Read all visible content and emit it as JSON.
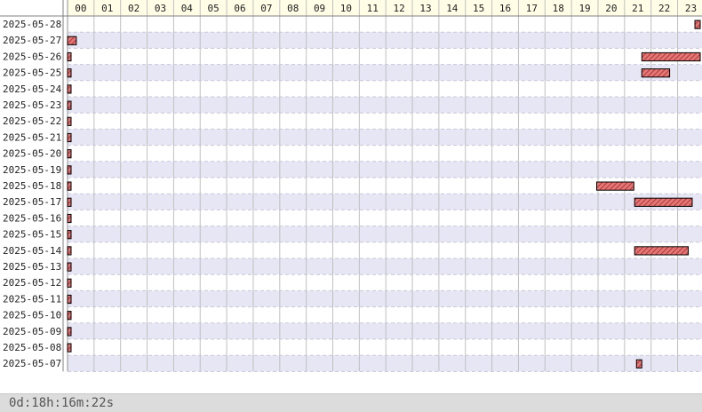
{
  "colors": {
    "header_bg": "#fffde6",
    "row_alt_bg": "#e6e6f5",
    "row_bg": "#ffffff",
    "bar_fill": "#e07878",
    "bar_hatch": "#b02222",
    "bar_border": "#000000",
    "grid_line": "#c0c0c0",
    "footer_bg": "#dcdcdc"
  },
  "hours": [
    "00",
    "01",
    "02",
    "03",
    "04",
    "05",
    "06",
    "07",
    "08",
    "09",
    "10",
    "11",
    "12",
    "13",
    "14",
    "15",
    "16",
    "17",
    "18",
    "19",
    "20",
    "21",
    "22",
    "23"
  ],
  "dates": [
    "2025-05-28",
    "2025-05-27",
    "2025-05-26",
    "2025-05-25",
    "2025-05-24",
    "2025-05-23",
    "2025-05-22",
    "2025-05-21",
    "2025-05-20",
    "2025-05-19",
    "2025-05-18",
    "2025-05-17",
    "2025-05-16",
    "2025-05-15",
    "2025-05-14",
    "2025-05-13",
    "2025-05-12",
    "2025-05-11",
    "2025-05-10",
    "2025-05-09",
    "2025-05-08",
    "2025-05-07"
  ],
  "spans": [
    {
      "row": 0,
      "start": 23.8,
      "end": 24.0
    },
    {
      "row": 1,
      "start": 0.0,
      "end": 0.33
    },
    {
      "row": 2,
      "start": 0.0,
      "end": 0.05
    },
    {
      "row": 2,
      "start": 21.8,
      "end": 24.0
    },
    {
      "row": 3,
      "start": 0.0,
      "end": 0.05
    },
    {
      "row": 3,
      "start": 21.65,
      "end": 22.7
    },
    {
      "row": 4,
      "start": 0.0,
      "end": 0.05
    },
    {
      "row": 5,
      "start": 0.0,
      "end": 0.05
    },
    {
      "row": 6,
      "start": 0.0,
      "end": 0.05
    },
    {
      "row": 7,
      "start": 0.0,
      "end": 0.05
    },
    {
      "row": 8,
      "start": 0.0,
      "end": 0.05
    },
    {
      "row": 9,
      "start": 0.0,
      "end": 0.05
    },
    {
      "row": 10,
      "start": 0.0,
      "end": 0.05
    },
    {
      "row": 10,
      "start": 19.95,
      "end": 21.35
    },
    {
      "row": 11,
      "start": 0.0,
      "end": 0.05
    },
    {
      "row": 11,
      "start": 21.38,
      "end": 23.55
    },
    {
      "row": 12,
      "start": 0.0,
      "end": 0.05
    },
    {
      "row": 13,
      "start": 0.0,
      "end": 0.05
    },
    {
      "row": 14,
      "start": 0.0,
      "end": 0.05
    },
    {
      "row": 14,
      "start": 21.38,
      "end": 23.4
    },
    {
      "row": 15,
      "start": 0.0,
      "end": 0.05
    },
    {
      "row": 16,
      "start": 0.0,
      "end": 0.05
    },
    {
      "row": 17,
      "start": 0.0,
      "end": 0.05
    },
    {
      "row": 18,
      "start": 0.0,
      "end": 0.05
    },
    {
      "row": 19,
      "start": 0.0,
      "end": 0.05
    },
    {
      "row": 20,
      "start": 0.0,
      "end": 0.05
    },
    {
      "row": 21,
      "start": 21.45,
      "end": 21.65
    }
  ],
  "footer": {
    "duration": "0d:18h:16m:22s"
  }
}
